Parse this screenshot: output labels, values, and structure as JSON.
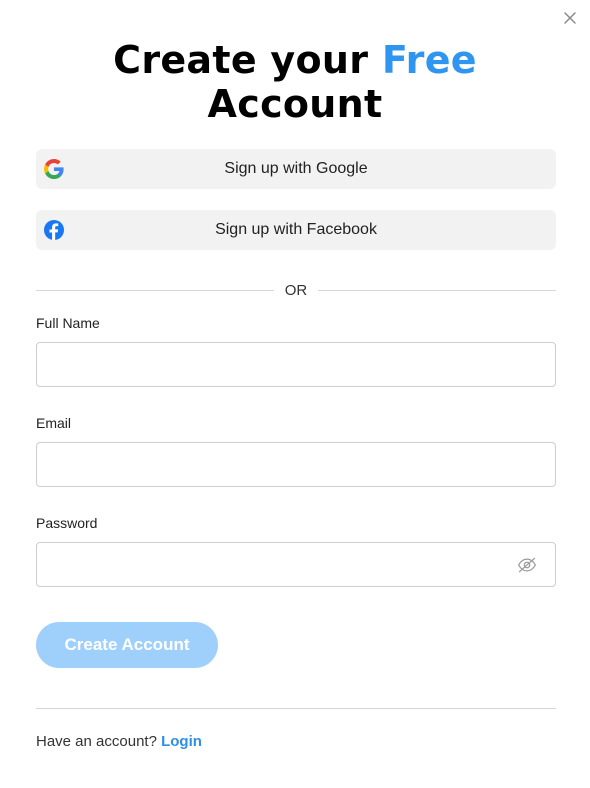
{
  "title": {
    "line1": "Create your",
    "accent": "Free",
    "line2": "Account"
  },
  "colors": {
    "accent": "#2e96f0",
    "button": "#9fd0fb",
    "link": "#2e8fe5"
  },
  "social": {
    "google": {
      "label": "Sign up with Google",
      "icon": "google-icon"
    },
    "facebook": {
      "label": "Sign up with Facebook",
      "icon": "facebook-icon"
    }
  },
  "divider": {
    "text": "OR"
  },
  "form": {
    "full_name": {
      "label": "Full Name",
      "value": ""
    },
    "email": {
      "label": "Email",
      "value": ""
    },
    "password": {
      "label": "Password",
      "value": "",
      "icon": "eye-slash-icon"
    }
  },
  "submit": {
    "label": "Create Account"
  },
  "footer": {
    "prompt": "Have an account?",
    "link": "Login"
  },
  "close": {
    "icon": "close-icon"
  }
}
